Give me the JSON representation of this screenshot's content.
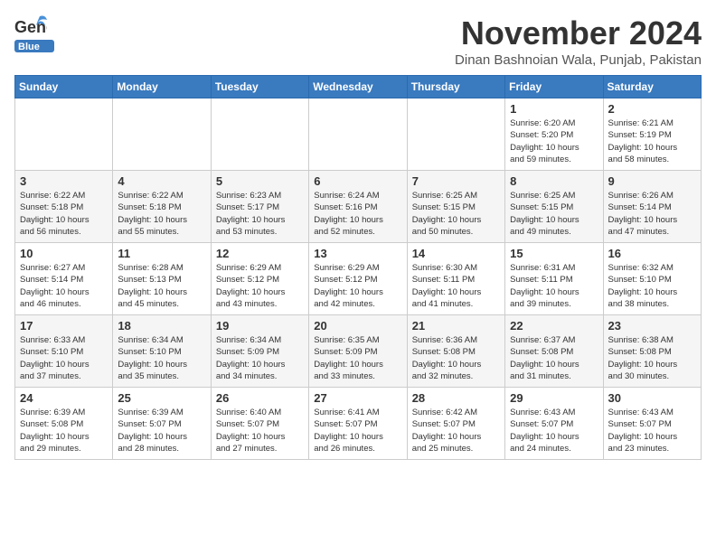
{
  "logo": {
    "line1": "General",
    "line2": "Blue"
  },
  "title": "November 2024",
  "location": "Dinan Bashnoian Wala, Punjab, Pakistan",
  "days_of_week": [
    "Sunday",
    "Monday",
    "Tuesday",
    "Wednesday",
    "Thursday",
    "Friday",
    "Saturday"
  ],
  "weeks": [
    [
      {
        "day": "",
        "info": ""
      },
      {
        "day": "",
        "info": ""
      },
      {
        "day": "",
        "info": ""
      },
      {
        "day": "",
        "info": ""
      },
      {
        "day": "",
        "info": ""
      },
      {
        "day": "1",
        "info": "Sunrise: 6:20 AM\nSunset: 5:20 PM\nDaylight: 10 hours\nand 59 minutes."
      },
      {
        "day": "2",
        "info": "Sunrise: 6:21 AM\nSunset: 5:19 PM\nDaylight: 10 hours\nand 58 minutes."
      }
    ],
    [
      {
        "day": "3",
        "info": "Sunrise: 6:22 AM\nSunset: 5:18 PM\nDaylight: 10 hours\nand 56 minutes."
      },
      {
        "day": "4",
        "info": "Sunrise: 6:22 AM\nSunset: 5:18 PM\nDaylight: 10 hours\nand 55 minutes."
      },
      {
        "day": "5",
        "info": "Sunrise: 6:23 AM\nSunset: 5:17 PM\nDaylight: 10 hours\nand 53 minutes."
      },
      {
        "day": "6",
        "info": "Sunrise: 6:24 AM\nSunset: 5:16 PM\nDaylight: 10 hours\nand 52 minutes."
      },
      {
        "day": "7",
        "info": "Sunrise: 6:25 AM\nSunset: 5:15 PM\nDaylight: 10 hours\nand 50 minutes."
      },
      {
        "day": "8",
        "info": "Sunrise: 6:25 AM\nSunset: 5:15 PM\nDaylight: 10 hours\nand 49 minutes."
      },
      {
        "day": "9",
        "info": "Sunrise: 6:26 AM\nSunset: 5:14 PM\nDaylight: 10 hours\nand 47 minutes."
      }
    ],
    [
      {
        "day": "10",
        "info": "Sunrise: 6:27 AM\nSunset: 5:14 PM\nDaylight: 10 hours\nand 46 minutes."
      },
      {
        "day": "11",
        "info": "Sunrise: 6:28 AM\nSunset: 5:13 PM\nDaylight: 10 hours\nand 45 minutes."
      },
      {
        "day": "12",
        "info": "Sunrise: 6:29 AM\nSunset: 5:12 PM\nDaylight: 10 hours\nand 43 minutes."
      },
      {
        "day": "13",
        "info": "Sunrise: 6:29 AM\nSunset: 5:12 PM\nDaylight: 10 hours\nand 42 minutes."
      },
      {
        "day": "14",
        "info": "Sunrise: 6:30 AM\nSunset: 5:11 PM\nDaylight: 10 hours\nand 41 minutes."
      },
      {
        "day": "15",
        "info": "Sunrise: 6:31 AM\nSunset: 5:11 PM\nDaylight: 10 hours\nand 39 minutes."
      },
      {
        "day": "16",
        "info": "Sunrise: 6:32 AM\nSunset: 5:10 PM\nDaylight: 10 hours\nand 38 minutes."
      }
    ],
    [
      {
        "day": "17",
        "info": "Sunrise: 6:33 AM\nSunset: 5:10 PM\nDaylight: 10 hours\nand 37 minutes."
      },
      {
        "day": "18",
        "info": "Sunrise: 6:34 AM\nSunset: 5:10 PM\nDaylight: 10 hours\nand 35 minutes."
      },
      {
        "day": "19",
        "info": "Sunrise: 6:34 AM\nSunset: 5:09 PM\nDaylight: 10 hours\nand 34 minutes."
      },
      {
        "day": "20",
        "info": "Sunrise: 6:35 AM\nSunset: 5:09 PM\nDaylight: 10 hours\nand 33 minutes."
      },
      {
        "day": "21",
        "info": "Sunrise: 6:36 AM\nSunset: 5:08 PM\nDaylight: 10 hours\nand 32 minutes."
      },
      {
        "day": "22",
        "info": "Sunrise: 6:37 AM\nSunset: 5:08 PM\nDaylight: 10 hours\nand 31 minutes."
      },
      {
        "day": "23",
        "info": "Sunrise: 6:38 AM\nSunset: 5:08 PM\nDaylight: 10 hours\nand 30 minutes."
      }
    ],
    [
      {
        "day": "24",
        "info": "Sunrise: 6:39 AM\nSunset: 5:08 PM\nDaylight: 10 hours\nand 29 minutes."
      },
      {
        "day": "25",
        "info": "Sunrise: 6:39 AM\nSunset: 5:07 PM\nDaylight: 10 hours\nand 28 minutes."
      },
      {
        "day": "26",
        "info": "Sunrise: 6:40 AM\nSunset: 5:07 PM\nDaylight: 10 hours\nand 27 minutes."
      },
      {
        "day": "27",
        "info": "Sunrise: 6:41 AM\nSunset: 5:07 PM\nDaylight: 10 hours\nand 26 minutes."
      },
      {
        "day": "28",
        "info": "Sunrise: 6:42 AM\nSunset: 5:07 PM\nDaylight: 10 hours\nand 25 minutes."
      },
      {
        "day": "29",
        "info": "Sunrise: 6:43 AM\nSunset: 5:07 PM\nDaylight: 10 hours\nand 24 minutes."
      },
      {
        "day": "30",
        "info": "Sunrise: 6:43 AM\nSunset: 5:07 PM\nDaylight: 10 hours\nand 23 minutes."
      }
    ]
  ]
}
